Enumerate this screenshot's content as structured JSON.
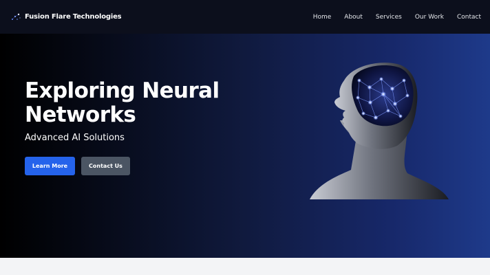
{
  "brand": {
    "name": "Fusion Flare Technologies",
    "logo_icon": "constellation-logo-icon"
  },
  "nav": {
    "items": [
      {
        "label": "Home"
      },
      {
        "label": "About"
      },
      {
        "label": "Services"
      },
      {
        "label": "Our Work"
      },
      {
        "label": "Contact"
      }
    ]
  },
  "hero": {
    "title": "Exploring Neural Networks",
    "subtitle": "Advanced AI Solutions",
    "primary_button": "Learn More",
    "secondary_button": "Contact Us",
    "image_subject": "human-head-neural-brain-image"
  },
  "colors": {
    "navbar_bg": "#0c0f1c",
    "hero_gradient_start": "#000000",
    "hero_gradient_end": "#1e3a8a",
    "primary_button": "#2563eb",
    "secondary_button": "#4b5563",
    "footer_bg": "#f3f4f6",
    "brain_glow": "#6b8cff"
  }
}
